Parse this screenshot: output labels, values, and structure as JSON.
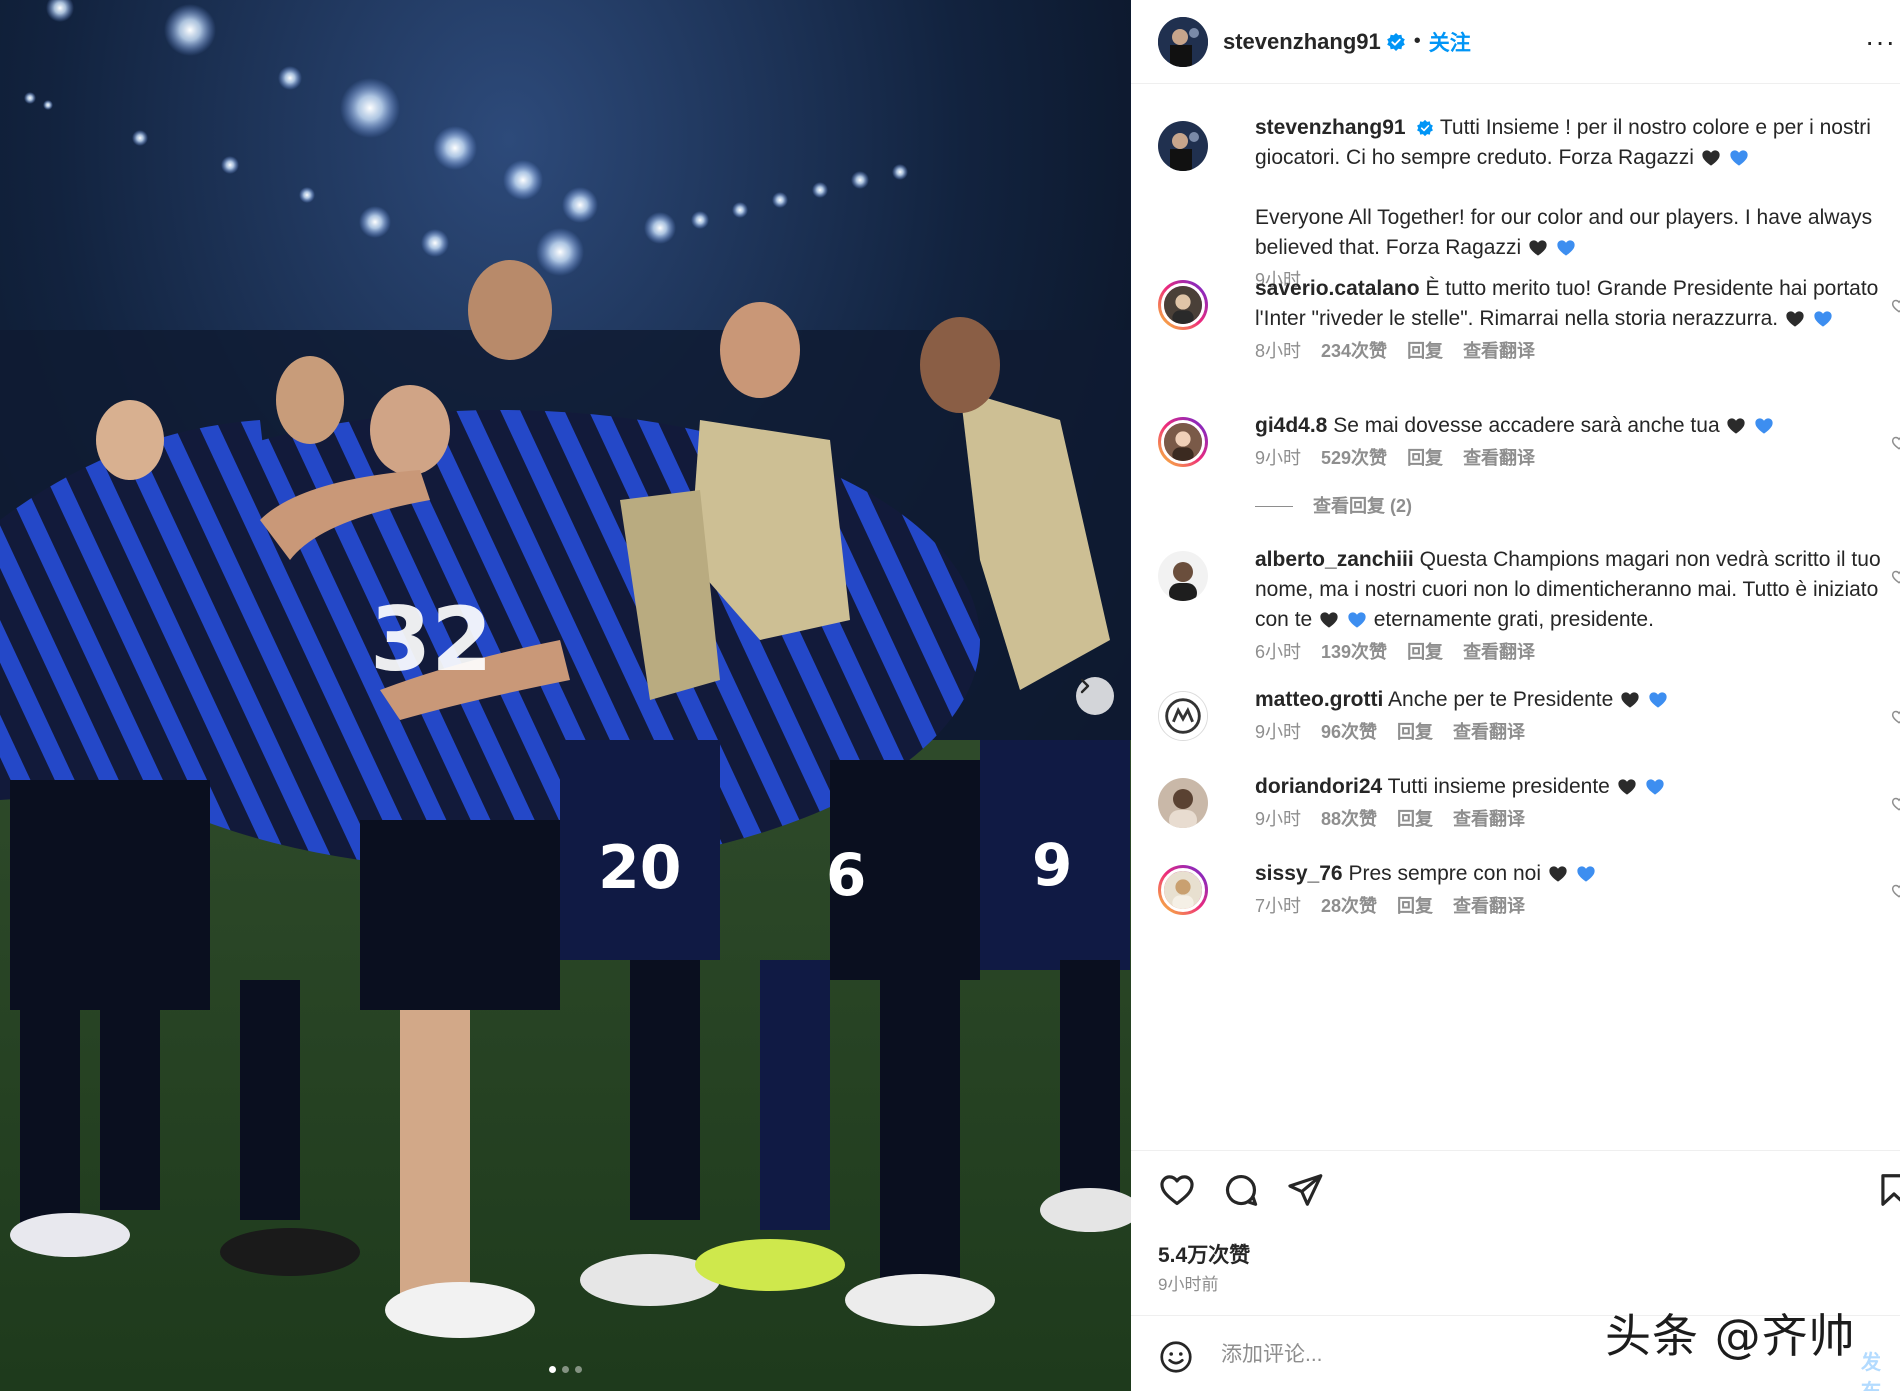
{
  "post": {
    "author": "stevenzhang91",
    "follow_label": "关注",
    "separator": "•",
    "caption_it": "Tutti Insieme ! per il nostro colore e per i nostri giocatori. Ci ho sempre creduto. Forza Ragazzi",
    "caption_en": "Everyone All Together! for our color and our players. I have always believed that. Forza Ragazzi",
    "caption_time": "9小时",
    "likes": "5.4万次赞",
    "posted_ago": "9小时前",
    "image_count": 3,
    "active_image_index": 0
  },
  "labels": {
    "reply": "回复",
    "translate": "查看翻译"
  },
  "comments": [
    {
      "user": "saverio.catalano",
      "text": "È tutto merito tuo! Grande Presidente hai portato l'Inter \"riveder le stelle\". Rimarrai nella storia nerazzurra.",
      "time": "8小时",
      "likes": "234次赞",
      "story_ring": true
    },
    {
      "user": "gi4d4.8",
      "text": "Se mai dovesse accadere sarà anche tua",
      "time": "9小时",
      "likes": "529次赞",
      "story_ring": true,
      "view_replies": "查看回复 (2)"
    },
    {
      "user": "alberto_zanchiii",
      "text": "Questa Champions magari non vedrà scritto il tuo nome, ma i nostri cuori non lo dimenticheranno mai. Tutto è iniziato con te",
      "text_after": "eternamente grati, presidente.",
      "time": "6小时",
      "likes": "139次赞",
      "story_ring": false
    },
    {
      "user": "matteo.grotti",
      "text": "Anche per te Presidente",
      "time": "9小时",
      "likes": "96次赞",
      "story_ring": false
    },
    {
      "user": "doriandori24",
      "text": "Tutti insieme presidente",
      "time": "9小时",
      "likes": "88次赞",
      "story_ring": false
    },
    {
      "user": "sissy_76",
      "text": "Pres sempre con noi",
      "time": "7小时",
      "likes": "28次赞",
      "story_ring": true
    }
  ],
  "composer": {
    "placeholder": "添加评论...",
    "post_label": "发布"
  },
  "watermark": "头条 @齐帅",
  "colors": {
    "accent": "#0095f6",
    "verified": "#0095f6",
    "meta_text": "#8e8e8e",
    "heart_black": "#2b2b2b",
    "heart_blue": "#3d8ef0"
  },
  "icons": [
    "verified-icon",
    "heart-icon",
    "comment-icon",
    "share-icon",
    "save-icon",
    "emoji-icon",
    "more-icon",
    "chevron-right-icon"
  ]
}
